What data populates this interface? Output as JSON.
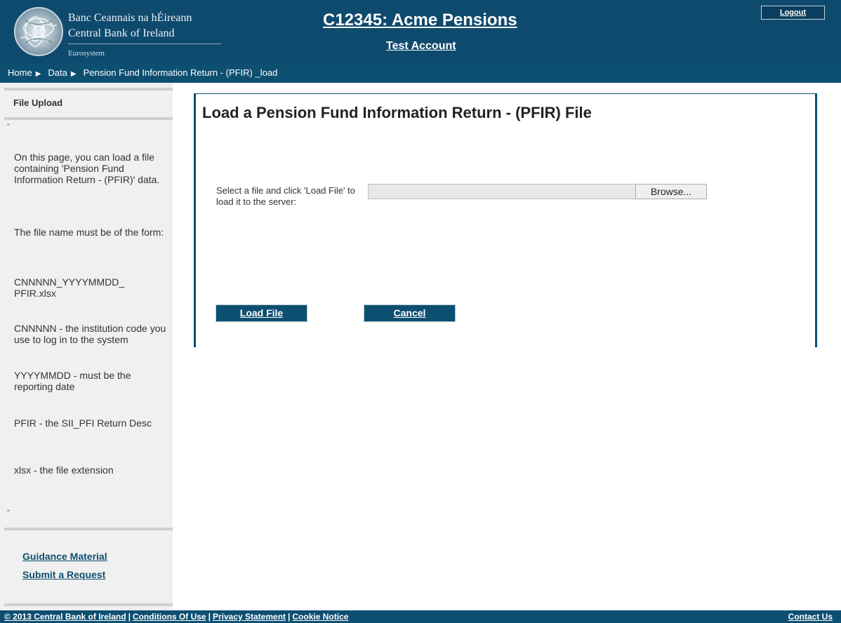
{
  "header": {
    "bank_name_irish": "Banc Ceannais na hÉireann",
    "bank_name_english": "Central Bank of Ireland",
    "eurosystem_label": "Eurosystem",
    "app_title": "C12345: Acme Pensions",
    "account_label": "Test Account",
    "logout_label": "Logout"
  },
  "breadcrumb": {
    "items": [
      "Home",
      "Data",
      "Pension Fund Information Return - (PFIR) _load"
    ]
  },
  "sidebar": {
    "heading": "File Upload",
    "quote_open": "\"",
    "quote_close": "\"",
    "paragraphs": [
      "On this page, you can load a file containing 'Pension Fund Information Return - (PFIR)' data.",
      "The file name must be of the form:",
      "CNNNNN_YYYYMMDD_ PFIR.xlsx",
      "CNNNNN - the institution code you use to log in to the system",
      "YYYYMMDD - must be the reporting date",
      "PFIR - the SII_PFI Return Desc",
      "xlsx - the file extension"
    ],
    "links": [
      "Guidance Material",
      "Submit a Request"
    ]
  },
  "main": {
    "title": "Load a Pension Fund Information Return - (PFIR) File",
    "file_label": "Select a file and click 'Load File' to load it to the server:",
    "file_input_value": "",
    "browse_label": "Browse...",
    "load_label": "Load File",
    "cancel_label": "Cancel"
  },
  "footer": {
    "copyright": "© 2013 Central Bank of Ireland",
    "links": [
      "Conditions Of Use",
      "Privacy Statement",
      "Cookie Notice"
    ],
    "contact_label": "Contact Us"
  },
  "colors": {
    "header_bg": "#0e4a6e",
    "breadcrumb_bg": "#0d4f71",
    "sidebar_bg": "#f0f0f0",
    "button_bg": "#0d4f71",
    "link_color": "#0d4f71"
  }
}
